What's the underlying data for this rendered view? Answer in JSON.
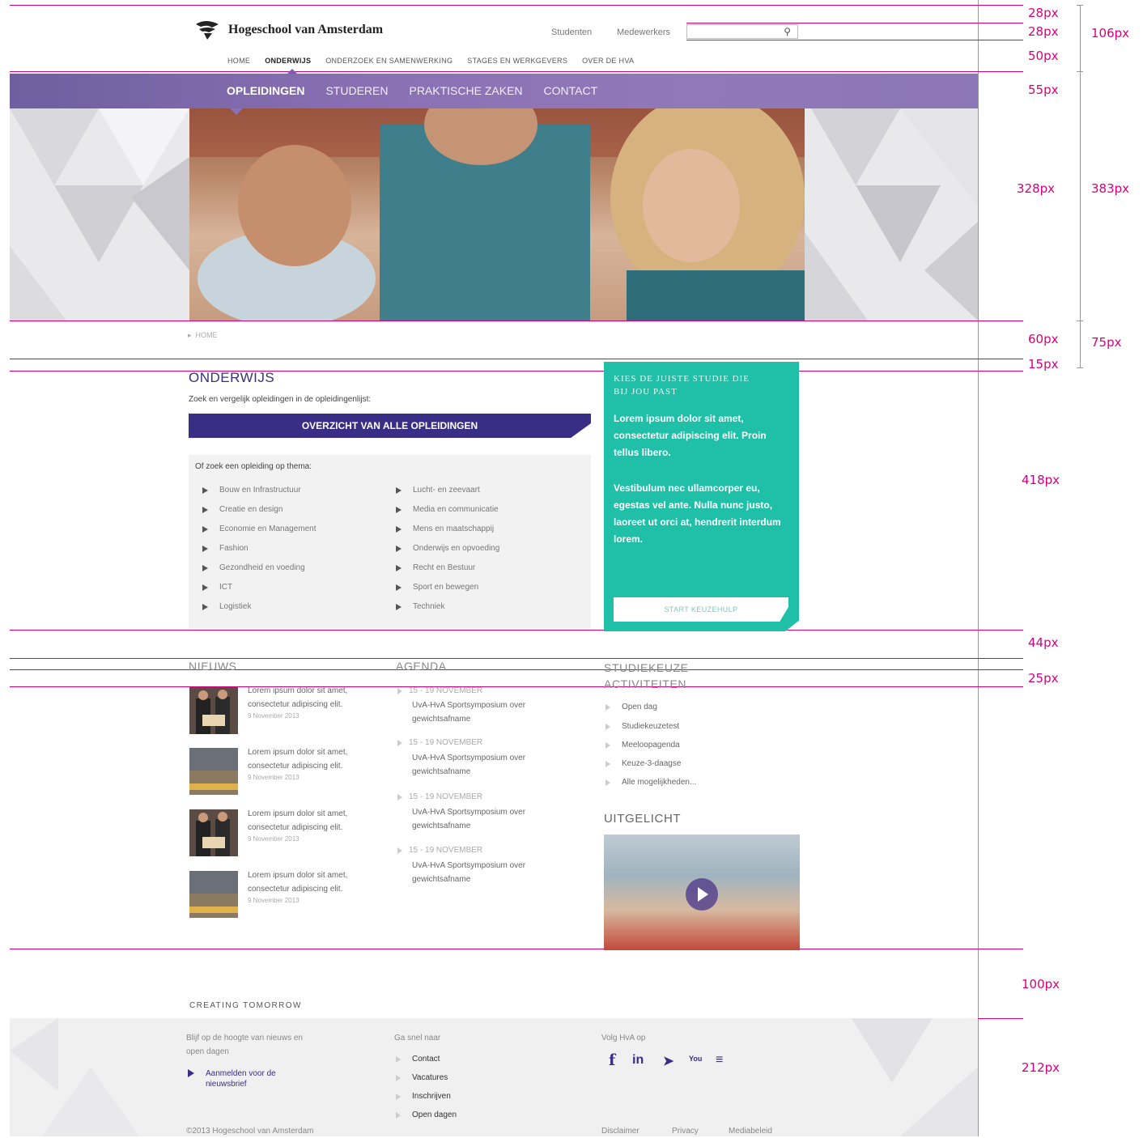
{
  "brand": {
    "name": "Hogeschool van Amsterdam"
  },
  "toplinks": [
    "Studenten",
    "Medewerkers"
  ],
  "main_nav": [
    "HOME",
    "ONDERWIJS",
    "ONDERZOEK EN SAMENWERKING",
    "STAGES EN WERKGEVERS",
    "OVER DE HVA"
  ],
  "sub_nav": [
    "OPLEIDINGEN",
    "STUDEREN",
    "PRAKTISCHE ZAKEN",
    "CONTACT"
  ],
  "breadcrumb": "HOME",
  "onderwijs": {
    "title": "ONDERWIJS",
    "intro": "Zoek en vergelijk opleidingen in de opleidingenlijst:",
    "cta": "OVERZICHT VAN ALLE OPLEIDINGEN",
    "themes_title": "Of zoek een opleiding op thema:",
    "themes_left": [
      "Bouw en Infrastructuur",
      "Creatie en design",
      "Economie en Management",
      "Fashion",
      "Gezondheid en voeding",
      "ICT",
      "Logistiek"
    ],
    "themes_right": [
      "Lucht- en zeevaart",
      "Media en communicatie",
      "Mens en maatschappij",
      "Onderwijs en opvoeding",
      "Recht en Bestuur",
      "Sport en bewegen",
      "Techniek"
    ]
  },
  "keuzehulp": {
    "title_1": "KIES DE JUISTE STUDIE DIE",
    "title_2": "BIJ JOU PAST",
    "p1": "Lorem ipsum dolor sit amet, consectetur adipiscing elit. Proin tellus libero.",
    "p2": "Vestibulum nec ullamcorper eu, egestas vel ante. Nulla nunc justo, laoreet ut orci at, hendrerit interdum lorem.",
    "button": "START KEUZEHULP"
  },
  "nieuws": {
    "title": "NIEUWS",
    "items": [
      {
        "text": "Lorem ipsum dolor sit amet, consectetur adipiscing elit.",
        "date": "9 November 2013"
      },
      {
        "text": "Lorem ipsum dolor sit amet, consectetur adipiscing elit.",
        "date": "9 November 2013"
      },
      {
        "text": "Lorem ipsum dolor sit amet, consectetur adipiscing elit.",
        "date": "9 November 2013"
      },
      {
        "text": "Lorem ipsum dolor sit amet, consectetur adipiscing elit.",
        "date": "9 November 2013"
      }
    ]
  },
  "agenda": {
    "title": "AGENDA",
    "items": [
      {
        "date": "15 - 19 NOVEMBER",
        "text": "UvA-HvA Sportsymposium over gewichtsafname"
      },
      {
        "date": "15 - 19 NOVEMBER",
        "text": "UvA-HvA Sportsymposium over gewichtsafname"
      },
      {
        "date": "15 - 19 NOVEMBER",
        "text": "UvA-HvA Sportsymposium over gewichtsafname"
      },
      {
        "date": "15 - 19 NOVEMBER",
        "text": "UvA-HvA Sportsymposium over gewichtsafname"
      }
    ]
  },
  "studiekeuze": {
    "title_1": "STUDIEKEUZE",
    "title_2": "ACTIVITEITEN",
    "items": [
      "Open dag",
      "Studiekeuzetest",
      "Meeloopagenda",
      "Keuze-3-daagse",
      "Alle mogelijkheden..."
    ]
  },
  "uitgelicht": {
    "title": "UITGELICHT"
  },
  "footer": {
    "tagline": "CREATING TOMORROW",
    "newsletter_intro": "Blijf op de hoogte van nieuws en open dagen",
    "newsletter_link": "Aanmelden voor de nieuwsbrief",
    "ga_snel": "Ga snel naar",
    "quick_links": [
      "Contact",
      "Vacatures",
      "Inschrijven",
      "Open dagen"
    ],
    "volg": "Volg HvA op",
    "social": [
      "f",
      "in",
      "➤",
      "You",
      "≡"
    ],
    "copyright": "©2013 Hogeschool van Amsterdam",
    "legal": [
      "Disclaimer",
      "Privacy",
      "Mediabeleid"
    ]
  },
  "annotations": [
    "28px",
    "28px",
    "50px",
    "55px",
    "328px",
    "60px",
    "15px",
    "418px",
    "44px",
    "25px",
    "100px",
    "212px",
    "106px",
    "383px",
    "75px"
  ],
  "colors": {
    "accent": "#d6007e",
    "purple": "#3a2d86",
    "nav_purple": "#8a71b4",
    "teal": "#1fbfa8"
  }
}
